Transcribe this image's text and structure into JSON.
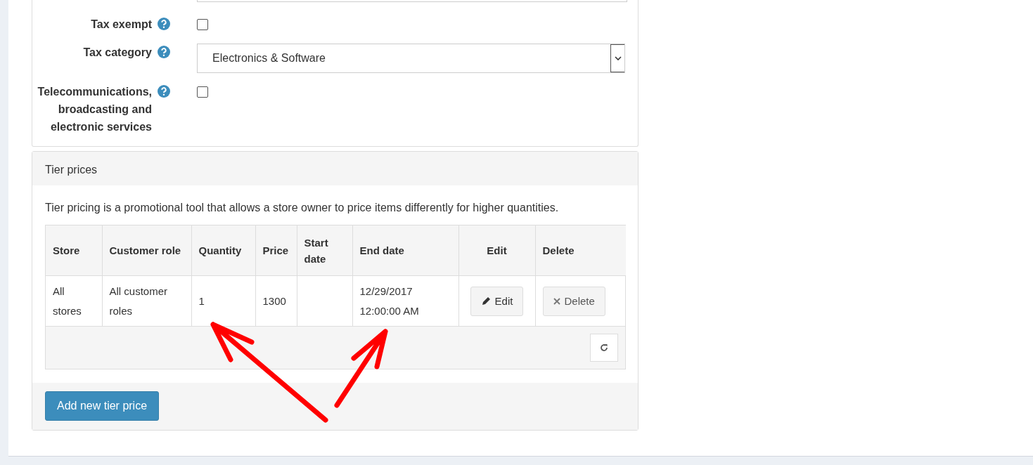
{
  "fields": [
    {
      "label": "Tax exempt",
      "kind": "checkbox",
      "checked": false
    },
    {
      "label": "Tax category",
      "kind": "select",
      "value": "Electronics & Software"
    },
    {
      "label": "Telecommunications, broadcasting and electronic services",
      "kind": "checkbox",
      "checked": false
    }
  ],
  "tier_prices": {
    "title": "Tier prices",
    "description": "Tier pricing is a promotional tool that allows a store owner to price items differently for higher quantities.",
    "columns": [
      "Store",
      "Customer role",
      "Quantity",
      "Price",
      "Start date",
      "End date",
      "Edit",
      "Delete"
    ],
    "rows": [
      {
        "cells": [
          "All stores",
          "All customer roles",
          "1",
          "1300",
          "",
          "12/29/2017 12:00:00 AM"
        ],
        "edit": "Edit",
        "delete": "Delete"
      }
    ],
    "add_button": "Add new tier price"
  }
}
